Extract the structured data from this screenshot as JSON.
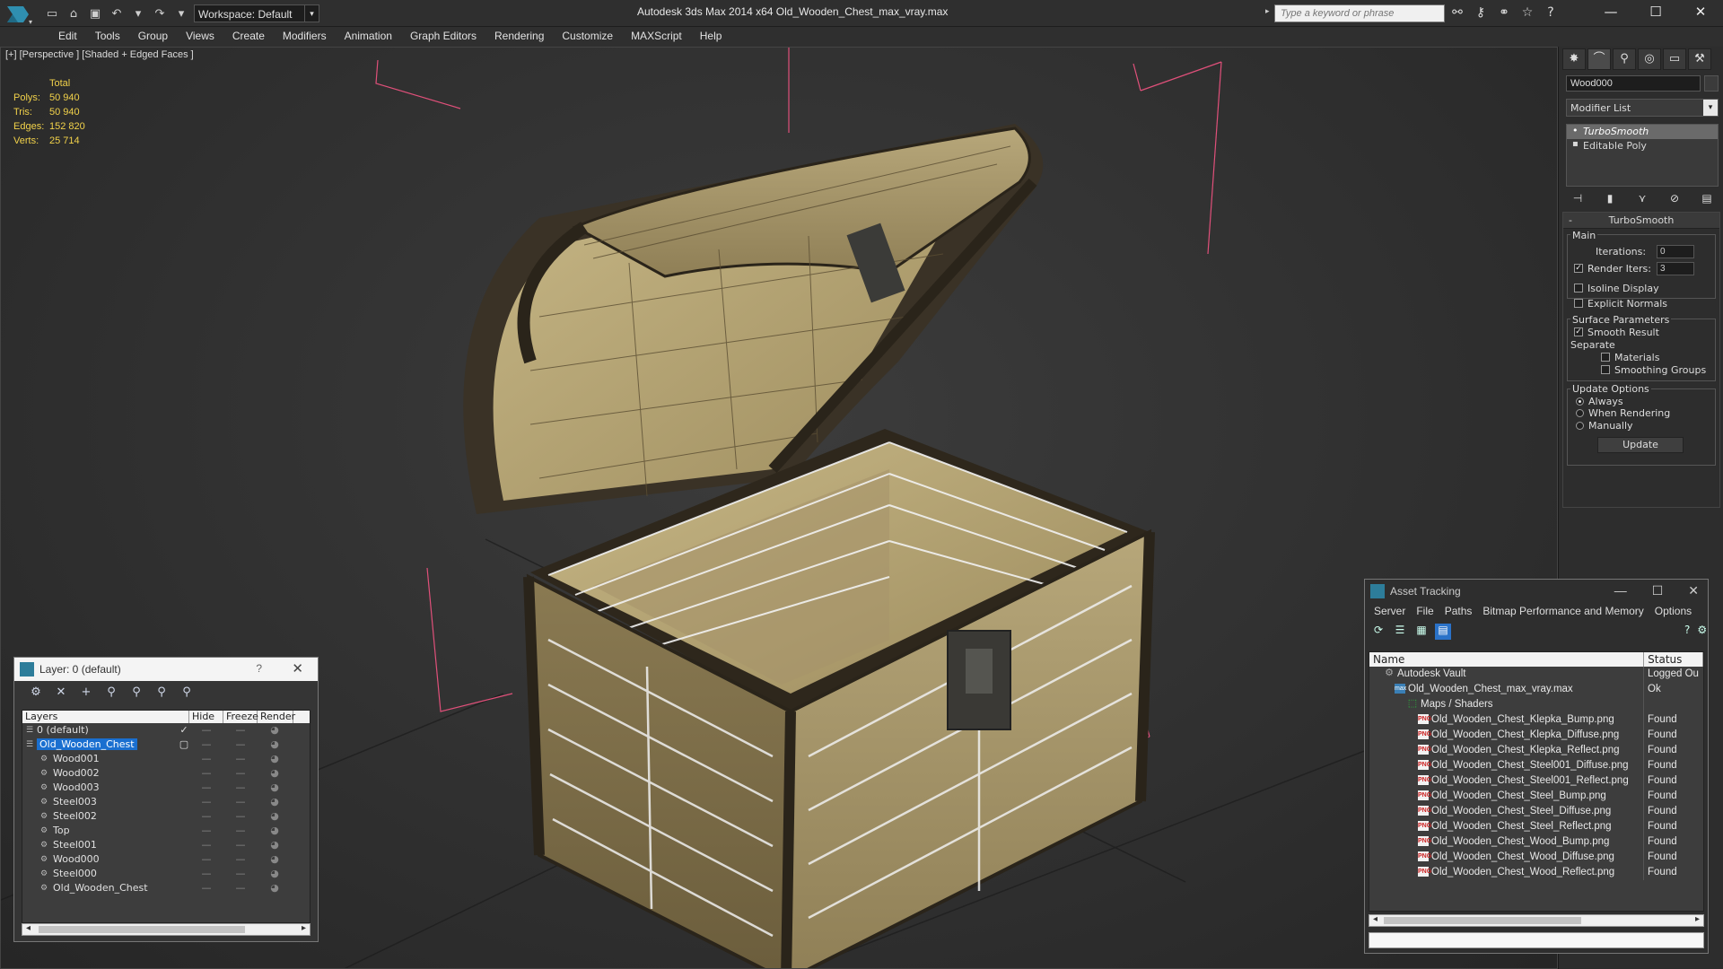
{
  "app": {
    "title": "Autodesk 3ds Max  2014 x64      Old_Wooden_Chest_max_vray.max",
    "workspace": "Workspace: Default",
    "search_placeholder": "Type a keyword or phrase"
  },
  "menu": [
    "Edit",
    "Tools",
    "Group",
    "Views",
    "Create",
    "Modifiers",
    "Animation",
    "Graph Editors",
    "Rendering",
    "Customize",
    "MAXScript",
    "Help"
  ],
  "viewport": {
    "label": "[+] [Perspective ] [Shaded + Edged Faces ]",
    "stats_header": "Total",
    "stats": [
      {
        "key": "Polys:",
        "value": "50 940"
      },
      {
        "key": "Tris:",
        "value": "50 940"
      },
      {
        "key": "Edges:",
        "value": "152 820"
      },
      {
        "key": "Verts:",
        "value": "25 714"
      }
    ]
  },
  "command_panel": {
    "object_name": "Wood000",
    "modifier_list": "Modifier List",
    "stack": [
      "TurboSmooth",
      "Editable Poly"
    ],
    "rollout_title": "TurboSmooth",
    "main_group": "Main",
    "iterations_label": "Iterations:",
    "iterations_value": "0",
    "render_iters_label": "Render Iters:",
    "render_iters_value": "3",
    "isoline": "Isoline Display",
    "explicit_normals": "Explicit Normals",
    "surface_group": "Surface Parameters",
    "smooth_result": "Smooth Result",
    "separate": "Separate",
    "materials": "Materials",
    "smoothing_groups": "Smoothing Groups",
    "update_group": "Update Options",
    "always": "Always",
    "when_rendering": "When Rendering",
    "manually": "Manually",
    "update_button": "Update"
  },
  "layer_window": {
    "title": "Layer: 0 (default)",
    "help": "?",
    "columns": [
      "Layers",
      "Hide",
      "Freeze",
      "Render"
    ],
    "rows": [
      {
        "name": "0 (default)",
        "level": 0,
        "flag": "✓"
      },
      {
        "name": "Old_Wooden_Chest",
        "level": 0,
        "flag": "▢",
        "selected": true
      },
      {
        "name": "Wood001",
        "level": 1,
        "flag": ""
      },
      {
        "name": "Wood002",
        "level": 1,
        "flag": ""
      },
      {
        "name": "Wood003",
        "level": 1,
        "flag": ""
      },
      {
        "name": "Steel003",
        "level": 1,
        "flag": ""
      },
      {
        "name": "Steel002",
        "level": 1,
        "flag": ""
      },
      {
        "name": "Top",
        "level": 1,
        "flag": ""
      },
      {
        "name": "Steel001",
        "level": 1,
        "flag": ""
      },
      {
        "name": "Wood000",
        "level": 1,
        "flag": ""
      },
      {
        "name": "Steel000",
        "level": 1,
        "flag": ""
      },
      {
        "name": "Old_Wooden_Chest",
        "level": 1,
        "flag": ""
      }
    ]
  },
  "asset_window": {
    "title": "Asset Tracking",
    "menu": [
      "Server",
      "File",
      "Paths",
      "Bitmap Performance and Memory",
      "Options"
    ],
    "columns": [
      "Name",
      "Status"
    ],
    "rows": [
      {
        "name": "Autodesk Vault",
        "status": "Logged Ou",
        "indent": 16,
        "icon": "vault"
      },
      {
        "name": "Old_Wooden_Chest_max_vray.max",
        "status": "Ok",
        "indent": 28,
        "icon": "max"
      },
      {
        "name": "Maps / Shaders",
        "status": "",
        "indent": 42,
        "icon": "maps"
      },
      {
        "name": "Old_Wooden_Chest_Klepka_Bump.png",
        "status": "Found",
        "indent": 54,
        "icon": "png"
      },
      {
        "name": "Old_Wooden_Chest_Klepka_Diffuse.png",
        "status": "Found",
        "indent": 54,
        "icon": "png"
      },
      {
        "name": "Old_Wooden_Chest_Klepka_Reflect.png",
        "status": "Found",
        "indent": 54,
        "icon": "png"
      },
      {
        "name": "Old_Wooden_Chest_Steel001_Diffuse.png",
        "status": "Found",
        "indent": 54,
        "icon": "png"
      },
      {
        "name": "Old_Wooden_Chest_Steel001_Reflect.png",
        "status": "Found",
        "indent": 54,
        "icon": "png"
      },
      {
        "name": "Old_Wooden_Chest_Steel_Bump.png",
        "status": "Found",
        "indent": 54,
        "icon": "png"
      },
      {
        "name": "Old_Wooden_Chest_Steel_Diffuse.png",
        "status": "Found",
        "indent": 54,
        "icon": "png"
      },
      {
        "name": "Old_Wooden_Chest_Steel_Reflect.png",
        "status": "Found",
        "indent": 54,
        "icon": "png"
      },
      {
        "name": "Old_Wooden_Chest_Wood_Bump.png",
        "status": "Found",
        "indent": 54,
        "icon": "png"
      },
      {
        "name": "Old_Wooden_Chest_Wood_Diffuse.png",
        "status": "Found",
        "indent": 54,
        "icon": "png"
      },
      {
        "name": "Old_Wooden_Chest_Wood_Reflect.png",
        "status": "Found",
        "indent": 54,
        "icon": "png"
      }
    ]
  },
  "colors": {
    "stats_text": "#f2d24a",
    "selection": "#1a6fd0",
    "bounding_box": "#e0507a"
  }
}
